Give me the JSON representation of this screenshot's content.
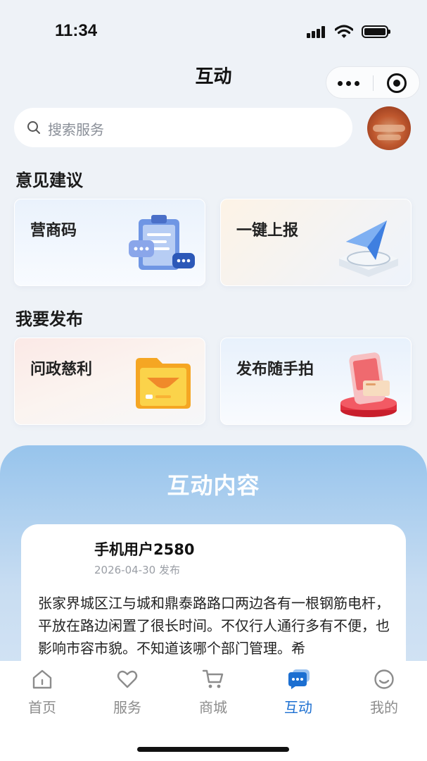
{
  "status_bar": {
    "time": "11:34"
  },
  "nav": {
    "title": "互动"
  },
  "search": {
    "placeholder": "搜索服务"
  },
  "sections": {
    "feedback_title": "意见建议",
    "publish_title": "我要发布"
  },
  "cards": {
    "business_code": "营商码",
    "one_click_report": "一键上报",
    "gov_inquiry": "问政慈利",
    "snapshot_post": "发布随手拍"
  },
  "interaction": {
    "title": "互动内容",
    "post": {
      "user": "手机用户2580",
      "date": "2026-04-30 发布",
      "body": "张家界城区江与城和鼎泰路路口两边各有一根钢筋电杆，平放在路边闲置了很长时间。不仅行人通行多有不便，也影响市容市貌。不知道该哪个部门管理。希"
    }
  },
  "tabbar": {
    "items": [
      {
        "label": "首页",
        "icon": "home-icon"
      },
      {
        "label": "服务",
        "icon": "heart-icon"
      },
      {
        "label": "商城",
        "icon": "cart-icon"
      },
      {
        "label": "互动",
        "icon": "chat-icon",
        "active": true
      },
      {
        "label": "我的",
        "icon": "profile-icon"
      }
    ]
  },
  "colors": {
    "accent": "#1c6fd1",
    "panel": "#97c4ec"
  }
}
